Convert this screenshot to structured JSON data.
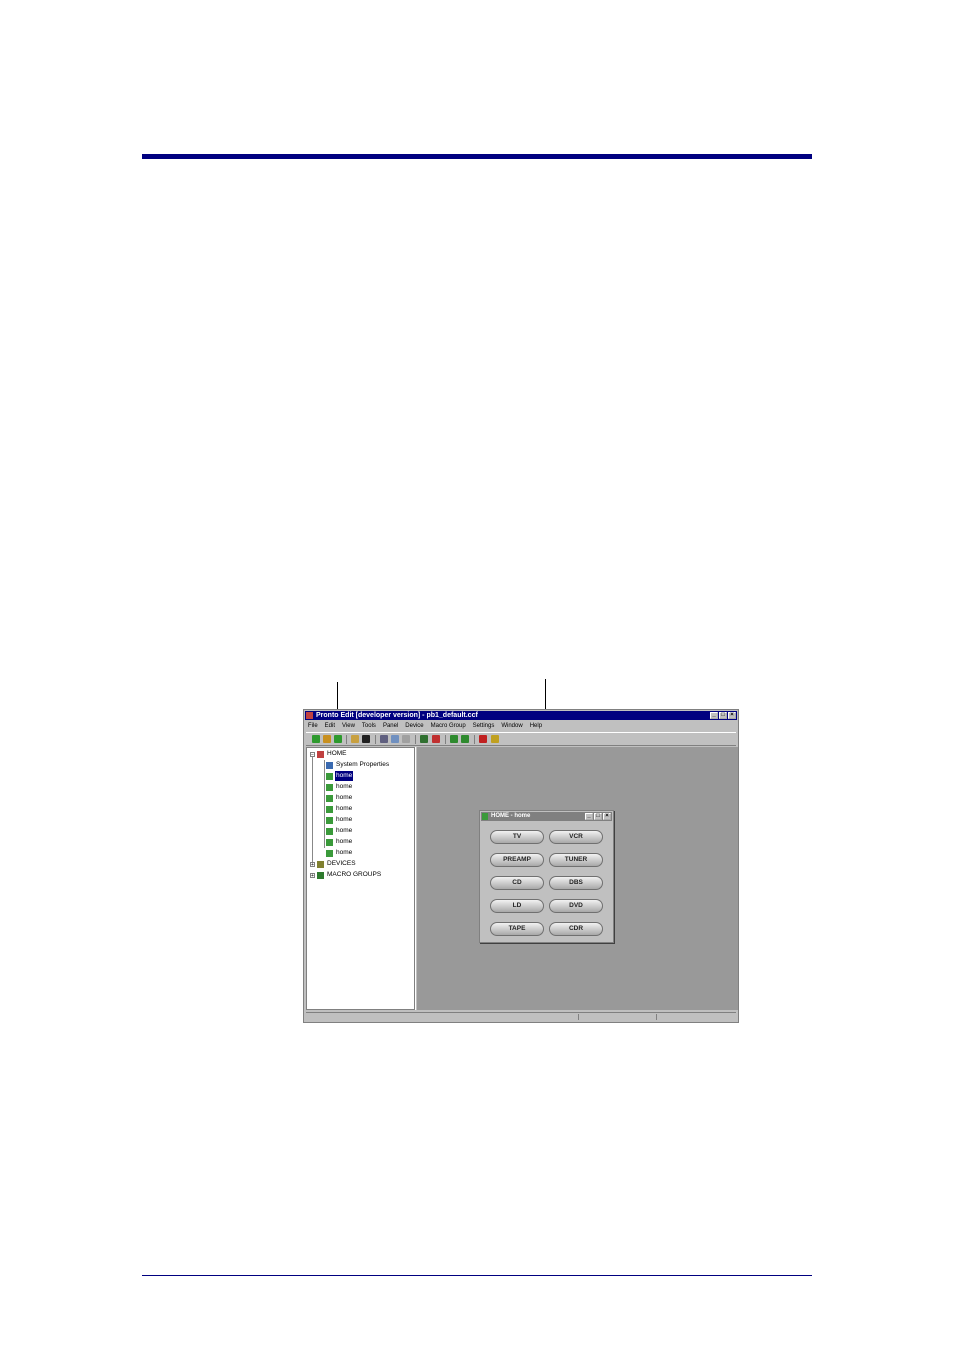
{
  "window": {
    "title": "Pronto Edit [developer version] - pb1_default.ccf",
    "menu": [
      "File",
      "Edit",
      "View",
      "Tools",
      "Panel",
      "Device",
      "Macro Group",
      "Settings",
      "Window",
      "Help"
    ],
    "toolbar_icons": [
      "new-icon",
      "open-icon",
      "save-icon",
      "open-folder-icon",
      "save-disk-icon",
      "cut-icon",
      "copy-icon",
      "paste-icon",
      "zoom-icon",
      "grid-icon",
      "refresh-icon",
      "sync-icon",
      "heart-icon",
      "pin-icon"
    ]
  },
  "tree": {
    "home": "HOME",
    "system_properties": "System Properties",
    "panels": [
      "home",
      "home",
      "home",
      "home",
      "home",
      "home",
      "home",
      "home"
    ],
    "selected_index": 0,
    "devices": "DEVICES",
    "macro_groups": "MACRO GROUPS"
  },
  "panel_window": {
    "title": "HOME - home",
    "buttons": [
      "TV",
      "VCR",
      "PREAMP",
      "TUNER",
      "CD",
      "DBS",
      "LD",
      "DVD",
      "TAPE",
      "CDR"
    ]
  },
  "colors": {
    "accent": "#000080",
    "window_bg": "#c0c0c0",
    "workspace": "#999999"
  }
}
